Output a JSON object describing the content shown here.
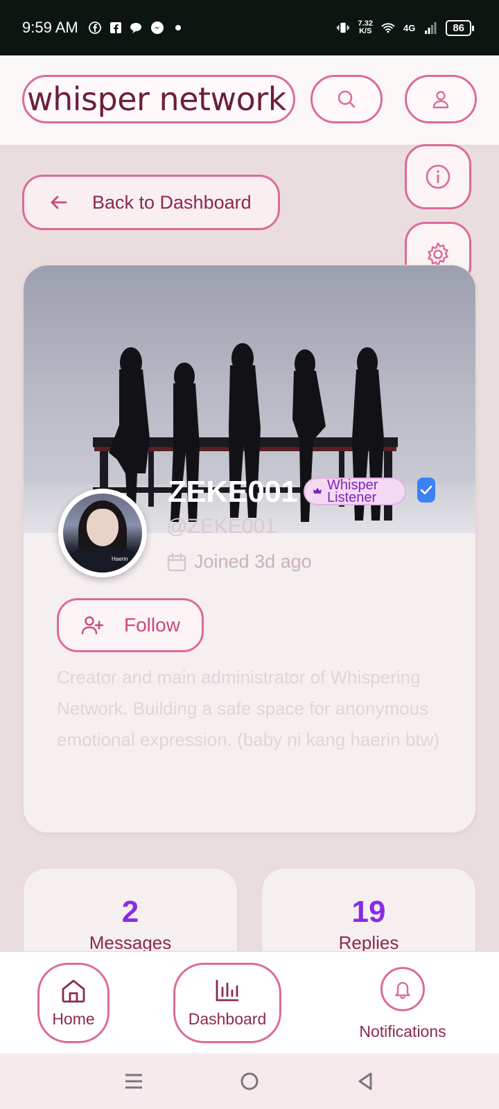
{
  "status_bar": {
    "time": "9:59 AM",
    "net_speed_value": "7.32",
    "net_speed_unit": "K/S",
    "network_type": "4G",
    "battery": "86"
  },
  "header": {
    "brand": "whisper network"
  },
  "back_button": {
    "label": "Back to Dashboard"
  },
  "profile": {
    "username": "ZEKE001",
    "role_badge": "Whisper Listener",
    "handle": "@ZEKE001",
    "joined": "Joined 3d ago",
    "follow_label": "Follow",
    "bio": "Creator and main administrator of Whispering Network. Building a safe space for anonymous emotional expression. (baby ni kang haerin btw)",
    "avatar_label": "Haerin"
  },
  "stats": [
    {
      "value": "2",
      "label": "Messages"
    },
    {
      "value": "19",
      "label": "Replies"
    }
  ],
  "bottom_nav": {
    "home": "Home",
    "dashboard": "Dashboard",
    "notifications": "Notifications"
  },
  "colors": {
    "accent": "#dc6a98",
    "brand_text": "#6b1f3b",
    "stat_number": "#8a2be2",
    "verified": "#3b82f6"
  }
}
